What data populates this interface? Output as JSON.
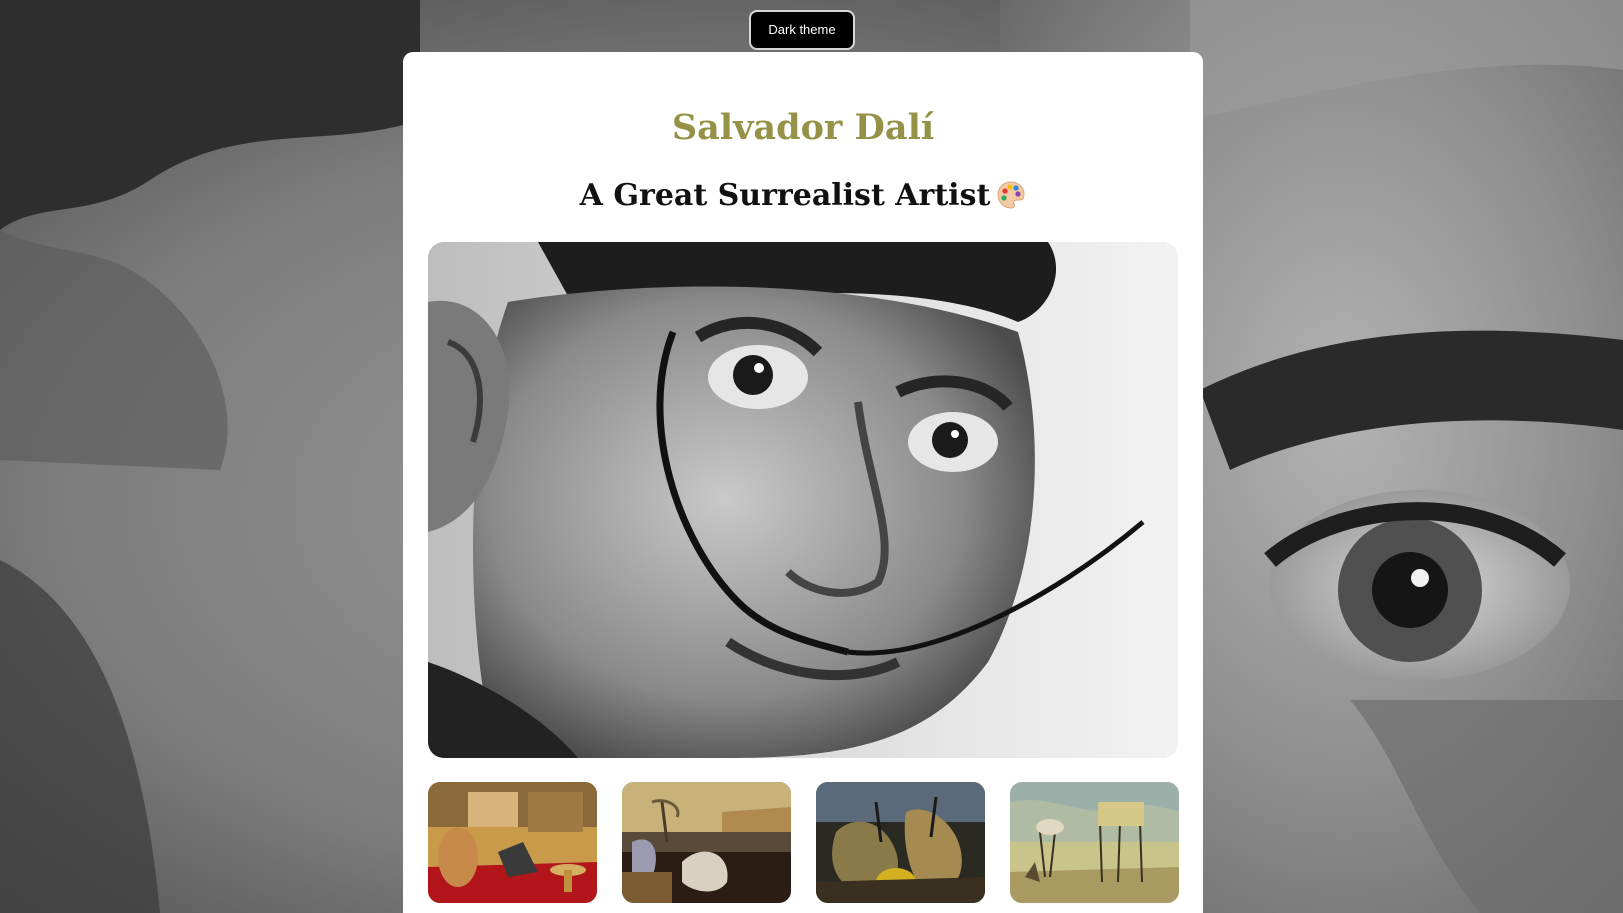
{
  "header": {
    "theme_toggle_label": "Dark theme"
  },
  "profile": {
    "name": "Salvador Dalí",
    "tagline": "A Great Surrealist Artist"
  },
  "icons": {
    "palette": "artist-palette-icon"
  },
  "gallery": {
    "thumbnails": [
      {
        "name": "thumbnail-painting-1"
      },
      {
        "name": "thumbnail-painting-2"
      },
      {
        "name": "thumbnail-painting-3"
      },
      {
        "name": "thumbnail-painting-4"
      }
    ]
  },
  "colors": {
    "title": "#959247",
    "subtitle": "#111111",
    "card_bg": "#ffffff",
    "button_bg": "#000000"
  }
}
